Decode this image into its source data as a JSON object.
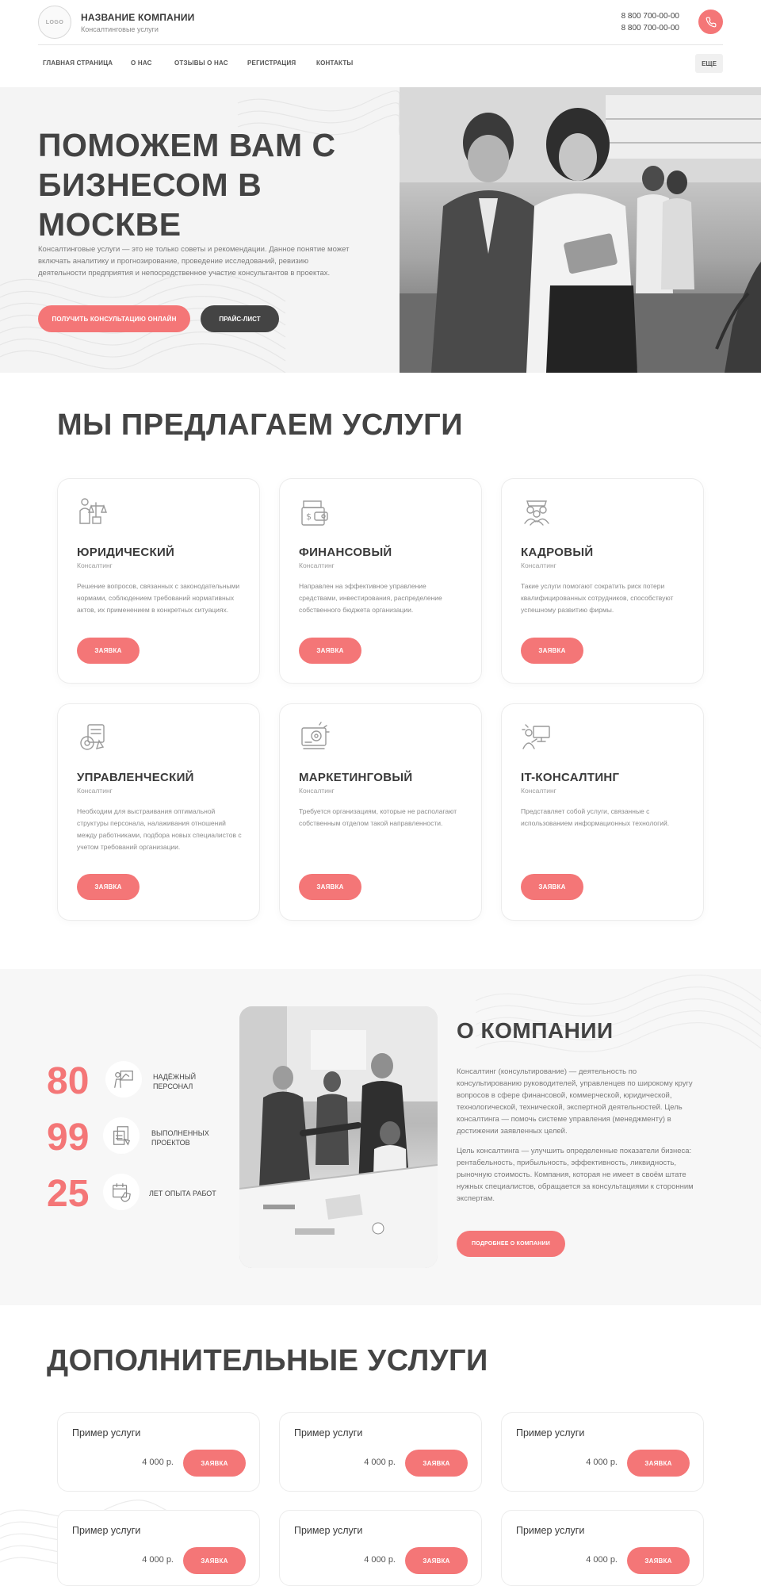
{
  "header": {
    "logo_text": "LOGO",
    "company_name": "НАЗВАНИЕ КОМПАНИИ",
    "company_sub": "Консалтинговые услуги",
    "phones": [
      "8 800 700-00-00",
      "8 800 700-00-00"
    ]
  },
  "nav": {
    "items": [
      "ГЛАВНАЯ СТРАНИЦА",
      "О НАС",
      "ОТЗЫВЫ О НАС",
      "РЕГИСТРАЦИЯ",
      "КОНТАКТЫ"
    ],
    "more": "ЕЩЕ"
  },
  "hero": {
    "title": "ПОМОЖЕМ ВАМ С БИЗНЕСОМ В МОСКВЕ",
    "description": "Консалтинговые услуги — это не только советы и рекомендации. Данное понятие может включать аналитику и прогнозирование, проведение исследований, ревизию деятельности предприятия и непосредственное участие консультантов в проектах.",
    "primary_button": "ПОЛУЧИТЬ КОНСУЛЬТАЦИЮ ОНЛАЙН",
    "secondary_button": "ПРАЙС-ЛИСТ"
  },
  "services": {
    "title": "МЫ ПРЕДЛАГАЕМ УСЛУГИ",
    "button_label": "ЗАЯВКА",
    "items": [
      {
        "title": "ЮРИДИЧЕСКИЙ",
        "subtitle": "Консалтинг",
        "description": "Решение вопросов, связанных с законодательными нормами, соблюдением требований нормативных актов, их применением в конкретных ситуациях.",
        "icon": "legal-scales-icon"
      },
      {
        "title": "ФИНАНСОВЫЙ",
        "subtitle": "Консалтинг",
        "description": "Направлен на эффективное управление средствами, инвестирования, распределение собственного бюджета организации.",
        "icon": "money-wallet-icon"
      },
      {
        "title": "КАДРОВЫЙ",
        "subtitle": "Консалтинг",
        "description": "Такие услуги помогают сократить риск потери квалифицированных сотрудников, способствуют успешному развитию фирмы.",
        "icon": "team-people-icon"
      },
      {
        "title": "УПРАВЛЕНЧЕСКИЙ",
        "subtitle": "Консалтинг",
        "description": "Необходим для выстраивания оптимальной структуры персонала, налаживания отношений между работниками, подбора новых специалистов с учетом требований организации.",
        "icon": "management-gear-icon"
      },
      {
        "title": "МАРКЕТИНГОВЫЙ",
        "subtitle": "Консалтинг",
        "description": "Требуется организациям, которые не располагают собственным отделом такой направленности.",
        "icon": "marketing-target-icon"
      },
      {
        "title": "IT-КОНСАЛТИНГ",
        "subtitle": "Консалтинг",
        "description": "Представляет собой услуги, связанные с использованием информационных технологий.",
        "icon": "computer-person-icon"
      }
    ]
  },
  "about": {
    "stats": [
      {
        "number": "80",
        "label": "НАДЁЖНЫЙ ПЕРСОНАЛ",
        "icon": "presenter-board-icon"
      },
      {
        "number": "99",
        "label": "ВЫПОЛНЕННЫХ ПРОЕКТОВ",
        "icon": "documents-icon"
      },
      {
        "number": "25",
        "label": "ЛЕТ ОПЫТА РАБОТ",
        "icon": "calendar-shield-icon"
      }
    ],
    "title": "О КОМПАНИИ",
    "paragraph1": "Консалтинг (консультирование) — деятельность по консультированию руководителей, управленцев по широкому кругу вопросов в сфере финансовой, коммерческой, юридической, технологической, технической, экспертной деятельностей. Цель консалтинга — помочь системе управления (менеджменту) в достижении заявленных целей.",
    "paragraph2": "Цель консалтинга — улучшить определенные показатели бизнеса: рентабельность, прибыльность, эффективность, ликвидность, рыночную стоимость. Компания, которая не имеет в своём штате нужных специалистов, обращается за консультациями к сторонним экспертам.",
    "button": "ПОДРОБНЕЕ О КОМПАНИИ"
  },
  "extra": {
    "title": "ДОПОЛНИТЕЛЬНЫЕ УСЛУГИ",
    "button_label": "ЗАЯВКА",
    "items": [
      {
        "name": "Пример услуги",
        "price": "4 000 р."
      },
      {
        "name": "Пример услуги",
        "price": "4 000 р."
      },
      {
        "name": "Пример услуги",
        "price": "4 000 р."
      },
      {
        "name": "Пример услуги",
        "price": "4 000 р."
      },
      {
        "name": "Пример услуги",
        "price": "4 000 р."
      },
      {
        "name": "Пример услуги",
        "price": "4 000 р."
      }
    ]
  },
  "colors": {
    "accent": "#f47677",
    "dark": "#444444",
    "text": "#3d3d3d",
    "muted": "#8a8a8a"
  }
}
